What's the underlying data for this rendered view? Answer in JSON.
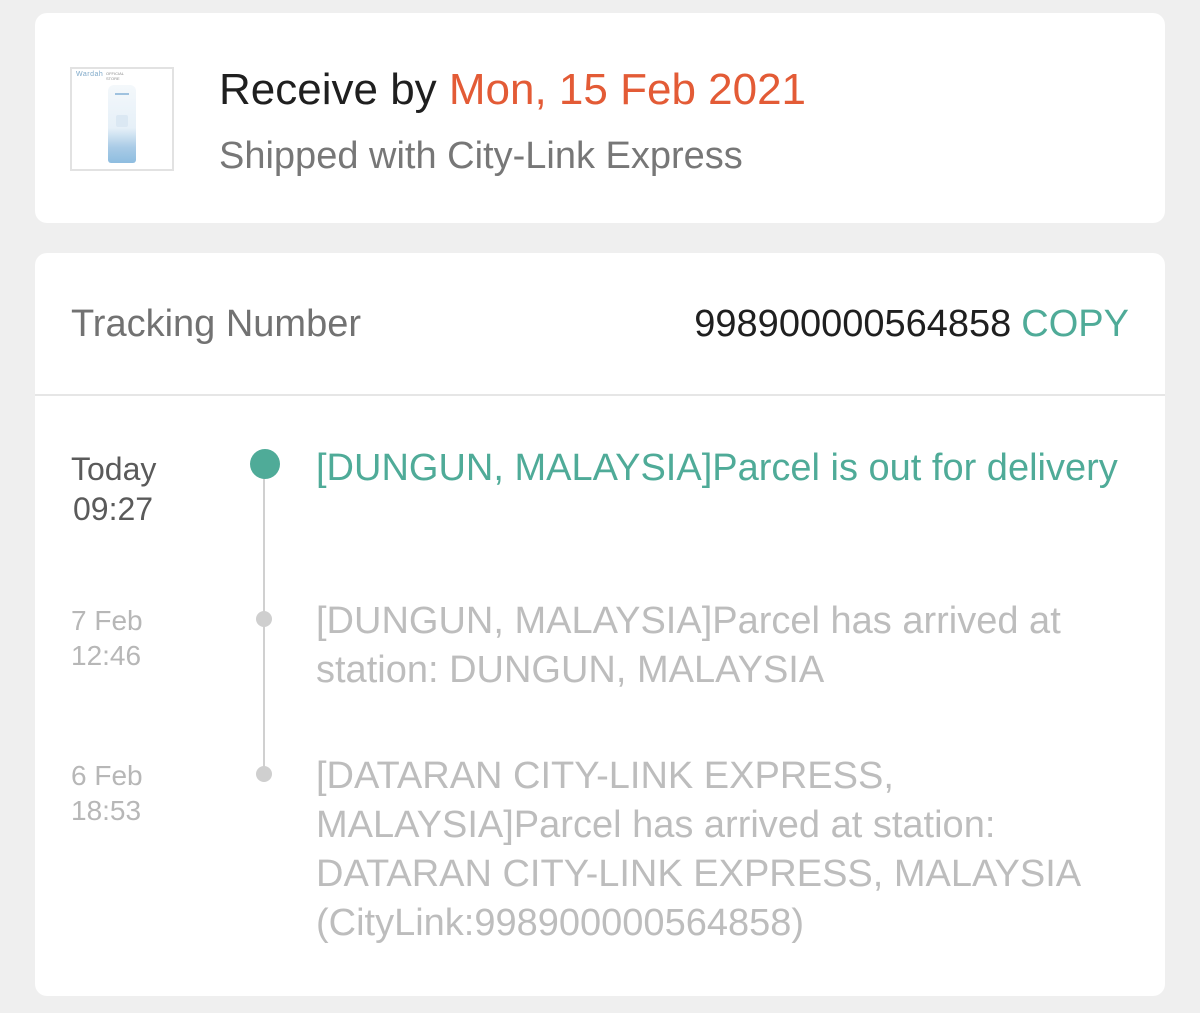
{
  "delivery": {
    "receive_prefix": "Receive by ",
    "receive_date": "Mon, 15 Feb 2021",
    "shipped_with": "Shipped with City-Link Express",
    "product_thumb": {
      "brand": "Wardah",
      "badge": "OFFICIAL STORE"
    }
  },
  "tracking": {
    "label": "Tracking Number",
    "number": "998900000564858",
    "copy_label": "COPY"
  },
  "events": [
    {
      "time_line1": "Today",
      "time_line2": "09:27",
      "text": "[DUNGUN, MALAYSIA]Parcel is out for delivery",
      "status": "current"
    },
    {
      "time_line1": "7 Feb",
      "time_line2": "12:46",
      "text": "[DUNGUN, MALAYSIA]Parcel has arrived at station: DUNGUN, MALAYSIA",
      "status": "past"
    },
    {
      "time_line1": "6 Feb",
      "time_line2": "18:53",
      "text": "[DATARAN CITY-LINK EXPRESS, MALAYSIA]Parcel has arrived at station: DATARAN CITY-LINK EXPRESS, MALAYSIA (CityLink:998900000564858)",
      "status": "past"
    }
  ],
  "colors": {
    "accent": "#4fab98",
    "date_highlight": "#e35b36",
    "background": "#efefef"
  }
}
